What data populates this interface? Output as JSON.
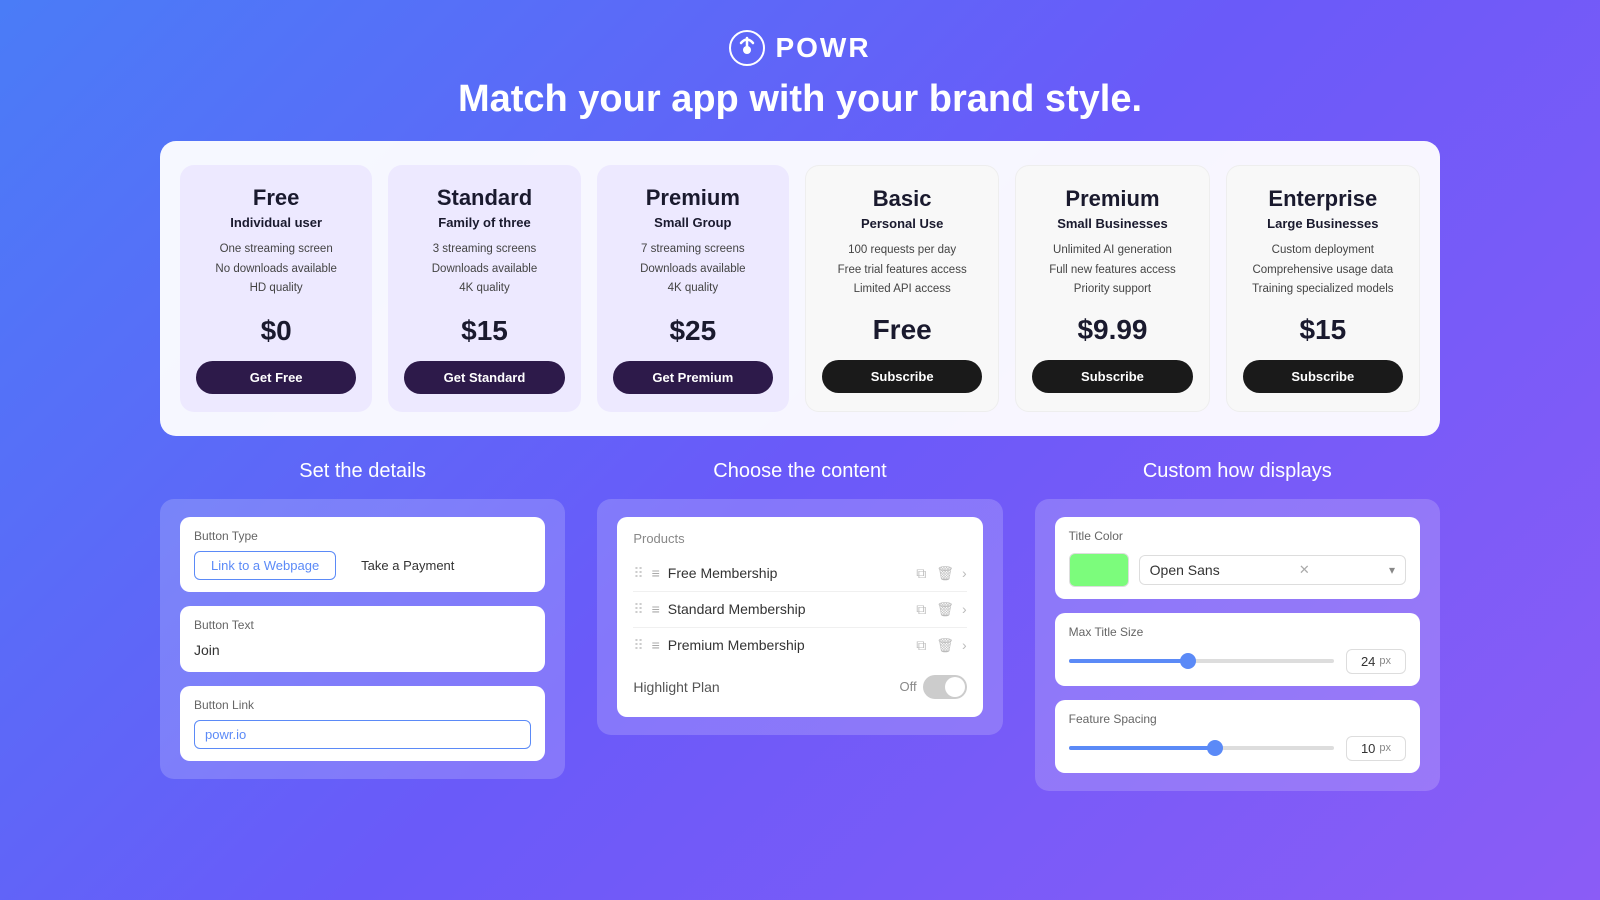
{
  "header": {
    "logo_text": "POWR",
    "tagline": "Match your app with your brand style."
  },
  "plans": [
    {
      "id": "free",
      "style": "purple",
      "title": "Free",
      "subtitle": "Individual user",
      "features": [
        "One streaming screen",
        "No downloads available",
        "HD quality"
      ],
      "price": "$0",
      "button_label": "Get Free",
      "button_style": "purple-btn"
    },
    {
      "id": "standard",
      "style": "purple",
      "title": "Standard",
      "subtitle": "Family of three",
      "features": [
        "3 streaming screens",
        "Downloads available",
        "4K quality"
      ],
      "price": "$15",
      "button_label": "Get Standard",
      "button_style": "purple-btn"
    },
    {
      "id": "premium",
      "style": "purple",
      "title": "Premium",
      "subtitle": "Small Group",
      "features": [
        "7 streaming screens",
        "Downloads available",
        "4K quality"
      ],
      "price": "$25",
      "button_label": "Get Premium",
      "button_style": "purple-btn"
    },
    {
      "id": "basic",
      "style": "white",
      "title": "Basic",
      "subtitle": "Personal Use",
      "features": [
        "100 requests per day",
        "Free trial features access",
        "Limited API access"
      ],
      "price": "Free",
      "button_label": "Subscribe",
      "button_style": "black-btn"
    },
    {
      "id": "premium2",
      "style": "white",
      "title": "Premium",
      "subtitle": "Small Businesses",
      "features": [
        "Unlimited AI generation",
        "Full new features access",
        "Priority support"
      ],
      "price": "$9.99",
      "button_label": "Subscribe",
      "button_style": "black-btn"
    },
    {
      "id": "enterprise",
      "style": "white",
      "title": "Enterprise",
      "subtitle": "Large Businesses",
      "features": [
        "Custom deployment",
        "Comprehensive usage data",
        "Training specialized models"
      ],
      "price": "$15",
      "button_label": "Subscribe",
      "button_style": "black-btn"
    }
  ],
  "set_details": {
    "heading": "Set the details",
    "button_type_label": "Button Type",
    "button_type_options": [
      "Link to a Webpage",
      "Take a Payment"
    ],
    "button_type_active": "Link to a Webpage",
    "button_text_label": "Button Text",
    "button_text_value": "Join",
    "button_link_label": "Button Link",
    "button_link_value": "powr.io"
  },
  "choose_content": {
    "heading": "Choose the content",
    "products_label": "Products",
    "products": [
      {
        "name": "Free Membership"
      },
      {
        "name": "Standard Membership"
      },
      {
        "name": "Premium Membership"
      }
    ],
    "highlight_plan_label": "Highlight Plan",
    "highlight_plan_state": "Off"
  },
  "custom_display": {
    "heading": "Custom how displays",
    "title_color_label": "Title Color",
    "font_name": "Open Sans",
    "color_hex": "#7cfc7c",
    "max_title_size_label": "Max Title Size",
    "max_title_size_value": "24",
    "max_title_size_percent": 45,
    "size_unit": "px",
    "feature_spacing_label": "Feature Spacing",
    "feature_spacing_value": "10",
    "feature_spacing_percent": 55,
    "spacing_unit": "px"
  }
}
